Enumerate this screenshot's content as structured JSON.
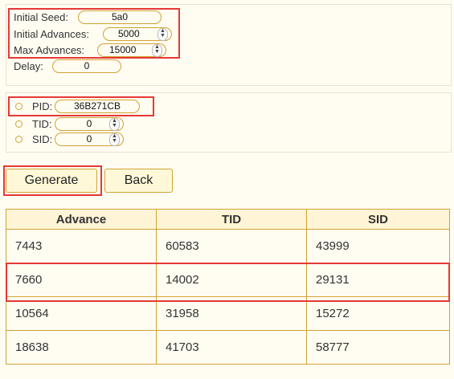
{
  "seed_section": {
    "initial_seed": {
      "label": "Initial Seed:",
      "value": "5a0"
    },
    "initial_advances": {
      "label": "Initial Advances:",
      "value": "5000"
    },
    "max_advances": {
      "label": "Max Advances:",
      "value": "15000"
    },
    "delay": {
      "label": "Delay:",
      "value": "0"
    }
  },
  "id_section": {
    "pid": {
      "label": "PID:",
      "value": "36B271CB"
    },
    "tid": {
      "label": "TID:",
      "value": "0"
    },
    "sid": {
      "label": "SID:",
      "value": "0"
    }
  },
  "buttons": {
    "generate": "Generate",
    "back": "Back"
  },
  "table": {
    "headers": [
      "Advance",
      "TID",
      "SID"
    ],
    "rows": [
      [
        "7443",
        "60583",
        "43999"
      ],
      [
        "7660",
        "14002",
        "29131"
      ],
      [
        "10564",
        "31958",
        "15272"
      ],
      [
        "18638",
        "41703",
        "58777"
      ]
    ]
  },
  "colors": {
    "accent": "#d1a233",
    "highlight": "#e53935",
    "background": "#fffdf2"
  }
}
